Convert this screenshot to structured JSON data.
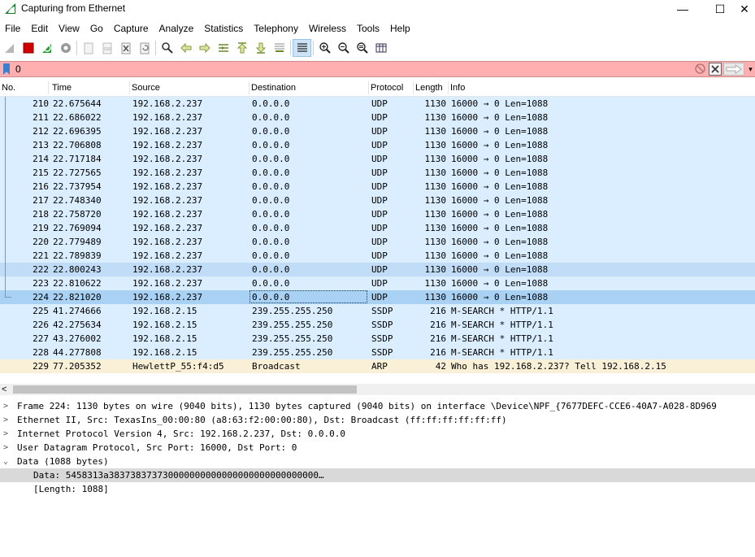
{
  "window": {
    "title": "Capturing from Ethernet",
    "minimize_glyph": "—",
    "maximize_glyph": "☐",
    "close_glyph": "✕"
  },
  "menu": [
    "File",
    "Edit",
    "View",
    "Go",
    "Capture",
    "Analyze",
    "Statistics",
    "Telephony",
    "Wireless",
    "Tools",
    "Help"
  ],
  "toolbar": {
    "icons": [
      "shark-fin-start-icon",
      "stop-capture-icon",
      "restart-capture-icon",
      "capture-options-icon",
      "open-file-icon",
      "save-file-icon",
      "close-file-icon",
      "reload-file-icon",
      "find-packet-icon",
      "go-back-icon",
      "go-forward-icon",
      "go-to-packet-icon",
      "go-first-icon",
      "go-last-icon",
      "auto-scroll-icon",
      "colorize-icon",
      "zoom-in-icon",
      "zoom-out-icon",
      "zoom-normal-icon",
      "resize-columns-icon"
    ]
  },
  "filter": {
    "value": "0",
    "status_color": "#ffafaf"
  },
  "columns": [
    "No.",
    "Time",
    "Source",
    "Destination",
    "Protocol",
    "Length",
    "Info"
  ],
  "colors": {
    "udp_row": "#daeeff",
    "udp_selected_light": "#c0dcf6",
    "udp_selected": "#a9d1f3",
    "arp_row": "#faf0d7",
    "detail_selected": "#d9d9d9"
  },
  "packets": [
    {
      "no": "210",
      "time": "22.675644",
      "src": "192.168.2.237",
      "dst": "0.0.0.0",
      "proto": "UDP",
      "len": "1130",
      "info": "16000 → 0 Len=1088"
    },
    {
      "no": "211",
      "time": "22.686022",
      "src": "192.168.2.237",
      "dst": "0.0.0.0",
      "proto": "UDP",
      "len": "1130",
      "info": "16000 → 0 Len=1088"
    },
    {
      "no": "212",
      "time": "22.696395",
      "src": "192.168.2.237",
      "dst": "0.0.0.0",
      "proto": "UDP",
      "len": "1130",
      "info": "16000 → 0 Len=1088"
    },
    {
      "no": "213",
      "time": "22.706808",
      "src": "192.168.2.237",
      "dst": "0.0.0.0",
      "proto": "UDP",
      "len": "1130",
      "info": "16000 → 0 Len=1088"
    },
    {
      "no": "214",
      "time": "22.717184",
      "src": "192.168.2.237",
      "dst": "0.0.0.0",
      "proto": "UDP",
      "len": "1130",
      "info": "16000 → 0 Len=1088"
    },
    {
      "no": "215",
      "time": "22.727565",
      "src": "192.168.2.237",
      "dst": "0.0.0.0",
      "proto": "UDP",
      "len": "1130",
      "info": "16000 → 0 Len=1088"
    },
    {
      "no": "216",
      "time": "22.737954",
      "src": "192.168.2.237",
      "dst": "0.0.0.0",
      "proto": "UDP",
      "len": "1130",
      "info": "16000 → 0 Len=1088"
    },
    {
      "no": "217",
      "time": "22.748340",
      "src": "192.168.2.237",
      "dst": "0.0.0.0",
      "proto": "UDP",
      "len": "1130",
      "info": "16000 → 0 Len=1088"
    },
    {
      "no": "218",
      "time": "22.758720",
      "src": "192.168.2.237",
      "dst": "0.0.0.0",
      "proto": "UDP",
      "len": "1130",
      "info": "16000 → 0 Len=1088"
    },
    {
      "no": "219",
      "time": "22.769094",
      "src": "192.168.2.237",
      "dst": "0.0.0.0",
      "proto": "UDP",
      "len": "1130",
      "info": "16000 → 0 Len=1088"
    },
    {
      "no": "220",
      "time": "22.779489",
      "src": "192.168.2.237",
      "dst": "0.0.0.0",
      "proto": "UDP",
      "len": "1130",
      "info": "16000 → 0 Len=1088"
    },
    {
      "no": "221",
      "time": "22.789839",
      "src": "192.168.2.237",
      "dst": "0.0.0.0",
      "proto": "UDP",
      "len": "1130",
      "info": "16000 → 0 Len=1088"
    },
    {
      "no": "222",
      "time": "22.800243",
      "src": "192.168.2.237",
      "dst": "0.0.0.0",
      "proto": "UDP",
      "len": "1130",
      "info": "16000 → 0 Len=1088"
    },
    {
      "no": "223",
      "time": "22.810622",
      "src": "192.168.2.237",
      "dst": "0.0.0.0",
      "proto": "UDP",
      "len": "1130",
      "info": "16000 → 0 Len=1088"
    },
    {
      "no": "224",
      "time": "22.821020",
      "src": "192.168.2.237",
      "dst": "0.0.0.0",
      "proto": "UDP",
      "len": "1130",
      "info": "16000 → 0 Len=1088"
    },
    {
      "no": "225",
      "time": "41.274666",
      "src": "192.168.2.15",
      "dst": "239.255.255.250",
      "proto": "SSDP",
      "len": "216",
      "info": "M-SEARCH * HTTP/1.1"
    },
    {
      "no": "226",
      "time": "42.275634",
      "src": "192.168.2.15",
      "dst": "239.255.255.250",
      "proto": "SSDP",
      "len": "216",
      "info": "M-SEARCH * HTTP/1.1"
    },
    {
      "no": "227",
      "time": "43.276002",
      "src": "192.168.2.15",
      "dst": "239.255.255.250",
      "proto": "SSDP",
      "len": "216",
      "info": "M-SEARCH * HTTP/1.1"
    },
    {
      "no": "228",
      "time": "44.277808",
      "src": "192.168.2.15",
      "dst": "239.255.255.250",
      "proto": "SSDP",
      "len": "216",
      "info": "M-SEARCH * HTTP/1.1"
    },
    {
      "no": "229",
      "time": "77.205352",
      "src": "HewlettP_55:f4:d5",
      "dst": "Broadcast",
      "proto": "ARP",
      "len": "42",
      "info": "Who has 192.168.2.237? Tell 192.168.2.15"
    }
  ],
  "details": [
    {
      "arrow": ">",
      "text": "Frame 224: 1130 bytes on wire (9040 bits), 1130 bytes captured (9040 bits) on interface \\Device\\NPF_{7677DEFC-CCE6-40A7-A028-8D969"
    },
    {
      "arrow": ">",
      "text": "Ethernet II, Src: TexasIns_00:00:80 (a8:63:f2:00:00:80), Dst: Broadcast (ff:ff:ff:ff:ff:ff)"
    },
    {
      "arrow": ">",
      "text": "Internet Protocol Version 4, Src: 192.168.2.237, Dst: 0.0.0.0"
    },
    {
      "arrow": ">",
      "text": "User Datagram Protocol, Src Port: 16000, Dst Port: 0"
    },
    {
      "arrow": "⌄",
      "text": "Data (1088 bytes)"
    },
    {
      "arrow": "",
      "text": "Data: 5458313a383738373730000000000000000000000000000…"
    },
    {
      "arrow": "",
      "text": "[Length: 1088]"
    }
  ],
  "scrollbar": {
    "left_glyph": "<"
  }
}
